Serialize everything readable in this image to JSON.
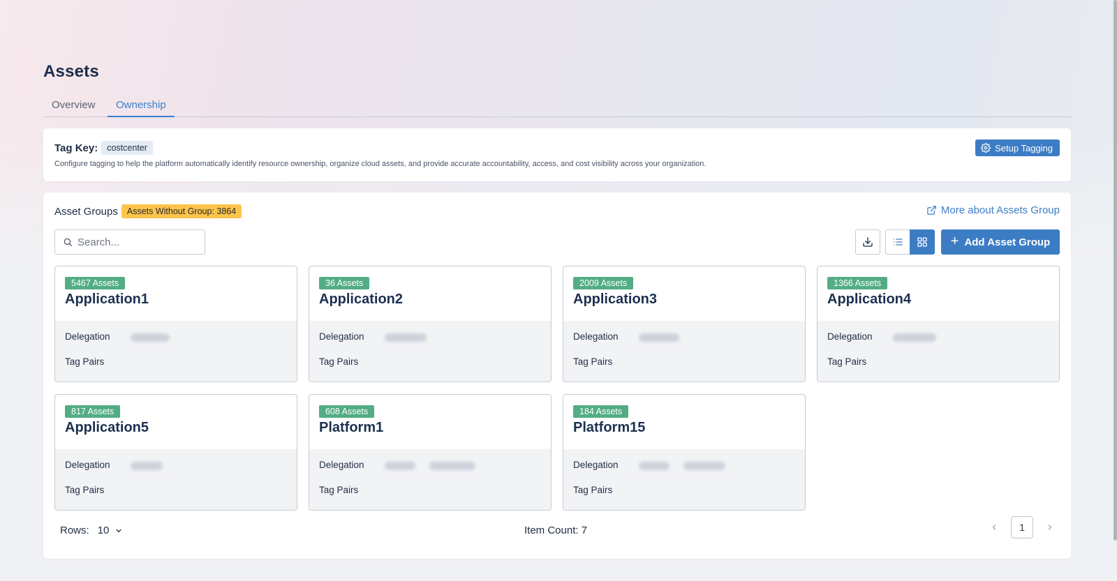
{
  "page": {
    "title": "Assets"
  },
  "tabs": [
    {
      "label": "Overview",
      "active": false
    },
    {
      "label": "Ownership",
      "active": true
    }
  ],
  "tag_key": {
    "label": "Tag Key:",
    "value": "costcenter",
    "description": "Configure tagging to help the platform automatically identify resource ownership, organize cloud assets, and provide accurate accountability, access, and cost visibility across your organization.",
    "setup_button": "Setup Tagging"
  },
  "asset_groups": {
    "title": "Asset Groups",
    "without_group_badge": "Assets Without Group: 3864",
    "more_link": "More about Assets Group",
    "search_placeholder": "Search...",
    "add_button": "Add Asset Group",
    "delegation_label": "Delegation",
    "tag_pairs_label": "Tag Pairs",
    "groups": [
      {
        "count": "5467 Assets",
        "name": "Application1"
      },
      {
        "count": "36 Assets",
        "name": "Application2"
      },
      {
        "count": "2009 Assets",
        "name": "Application3"
      },
      {
        "count": "1366 Assets",
        "name": "Application4"
      },
      {
        "count": "817 Assets",
        "name": "Application5"
      },
      {
        "count": "608 Assets",
        "name": "Platform1"
      },
      {
        "count": "184 Assets",
        "name": "Platform15"
      }
    ]
  },
  "footer": {
    "rows_label": "Rows:",
    "rows_value": "10",
    "item_count": "Item Count: 7",
    "current_page": "1"
  },
  "colors": {
    "accent": "#3c7cc4",
    "asset_badge": "#53ad84",
    "warning_badge": "#fcc44a"
  },
  "icons": [
    "gear-icon",
    "external-link-icon",
    "search-icon",
    "download-icon",
    "list-view-icon",
    "grid-view-icon",
    "plus-icon",
    "chevron-down-icon",
    "chevron-left-icon",
    "chevron-right-icon"
  ]
}
